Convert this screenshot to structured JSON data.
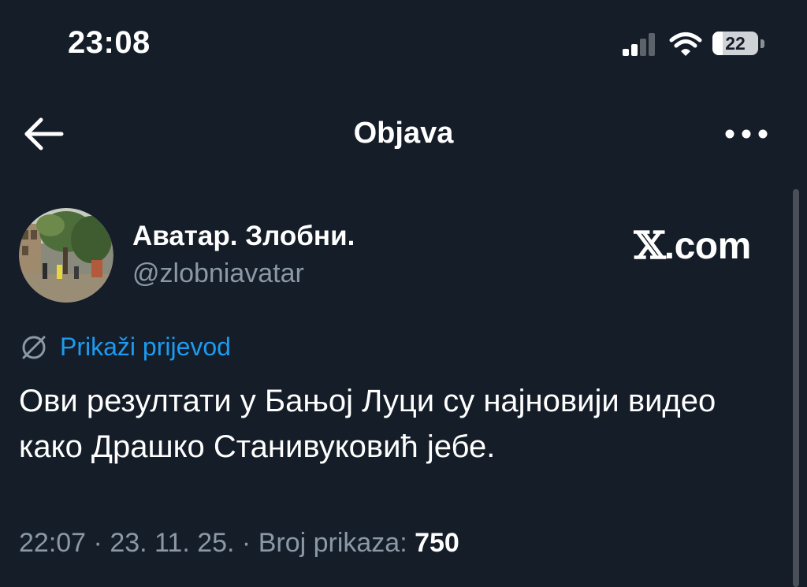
{
  "status_bar": {
    "time": "23:08",
    "battery_text": "22",
    "battery_level": 0.22,
    "signal_icon": "cellular-signal-icon",
    "wifi_icon": "wifi-icon",
    "battery_icon": "battery-icon"
  },
  "nav": {
    "title": "Objava",
    "back_icon": "arrow-left-icon",
    "more_icon": "ellipsis-icon"
  },
  "post": {
    "author": {
      "display_name": "Аватар. Злобни.",
      "handle": "@zlobniavatar"
    },
    "source": {
      "logo_mark": "𝕏",
      "logo_text": ".com"
    },
    "translate": {
      "icon": "globe-icon",
      "label": "Prikaži prijevod",
      "color": "#1d9bf0"
    },
    "text": "Ови резултати у Бањој Луци су најновији видео како Драшко Станивуковић јебе.",
    "meta": {
      "time": "22:07",
      "separator_1": " · ",
      "date": "23. 11. 25.",
      "separator_2": " · ",
      "views_label": "Broj prikaza: ",
      "views_count": "750"
    }
  },
  "colors": {
    "background": "#151d28",
    "text_primary": "#ffffff",
    "text_secondary": "#8b98a5",
    "accent": "#1d9bf0"
  }
}
